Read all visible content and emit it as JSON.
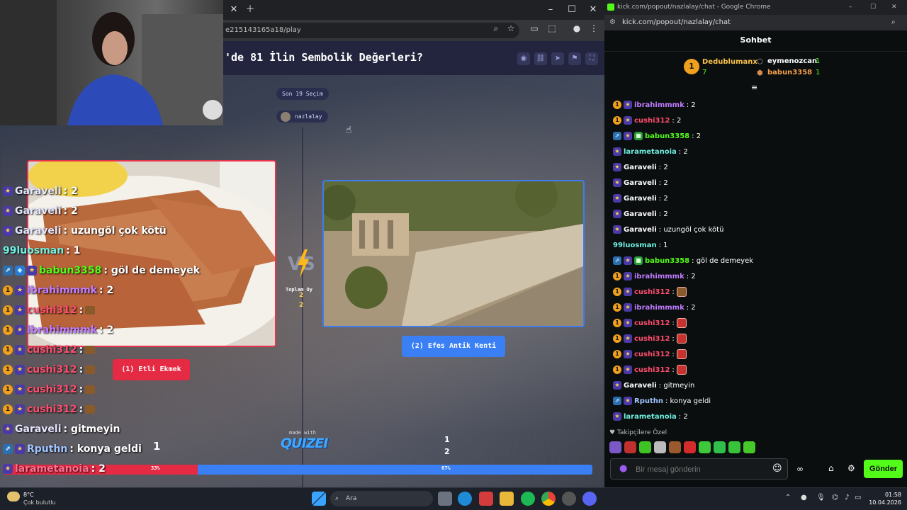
{
  "browser_left": {
    "address": "e215143165a18/play",
    "quiz_title": "'de 81 İlin Sembolik Değerleri?",
    "recent_pill": "Son 19 Seçim",
    "host_pill": "nazlalay",
    "option1_label": "(1) Etli Ekmek",
    "option2_label": "(2) Efes Antik Kenti",
    "vs_text": "VS",
    "total_label": "Toplam Oy",
    "total_num_top": "2",
    "total_num_bottom": "2",
    "made_with": "made with",
    "logo": "QUIZEI",
    "count_left": "1",
    "count_right_top": "1",
    "count_right_bottom": "2",
    "bar_left_pct": "33%",
    "bar_right_pct": "67%",
    "bar_left_value": 33
  },
  "overlay_chat": [
    {
      "user": "Garaveli",
      "text": " : 2",
      "color": "#e7e7ff",
      "badges": [
        "sub"
      ]
    },
    {
      "user": "Garaveli",
      "text": " : 2",
      "color": "#e7e7ff",
      "badges": [
        "sub"
      ]
    },
    {
      "user": "Garaveli",
      "text": " : uzungöl çok kötü",
      "color": "#e7e7ff",
      "badges": [
        "sub"
      ]
    },
    {
      "user": "99luosman",
      "text": " : 1",
      "color": "#6ff0e0",
      "badges": []
    },
    {
      "user": "babun3358",
      "text": " : göl de demeyek",
      "color": "#53fc18",
      "badges": [
        "og",
        "gift",
        "sub"
      ]
    },
    {
      "user": "ibrahimmmk",
      "text": " : 2",
      "color": "#c07cff",
      "badges": [
        "one",
        "sub"
      ]
    },
    {
      "user": "cushi312",
      "text": " :",
      "color": "#ff4d6d",
      "badges": [
        "one",
        "sub"
      ],
      "emote": true
    },
    {
      "user": "ibrahimmmk",
      "text": " : 2",
      "color": "#c07cff",
      "badges": [
        "one",
        "sub"
      ]
    },
    {
      "user": "cushi312",
      "text": " :",
      "color": "#ff4d6d",
      "badges": [
        "one",
        "sub"
      ],
      "emote": true
    },
    {
      "user": "cushi312",
      "text": " :",
      "color": "#ff4d6d",
      "badges": [
        "one",
        "sub"
      ],
      "emote": true
    },
    {
      "user": "cushi312",
      "text": " :",
      "color": "#ff4d6d",
      "badges": [
        "one",
        "sub"
      ],
      "emote": true
    },
    {
      "user": "cushi312",
      "text": " :",
      "color": "#ff4d6d",
      "badges": [
        "one",
        "sub"
      ],
      "emote": true
    },
    {
      "user": "Garaveli",
      "text": " : gitmeyin",
      "color": "#e7e7ff",
      "badges": [
        "sub"
      ]
    },
    {
      "user": "Rputhn",
      "text": " : konya geldi",
      "color": "#9fc4ff",
      "badges": [
        "og",
        "sub"
      ]
    },
    {
      "user": "larametanoia",
      "text": " : 2",
      "color": "#ff6f8f",
      "badges": [
        "sub"
      ]
    }
  ],
  "chat_window": {
    "title": "kick.com/popout/nazlalay/chat - Google Chrome",
    "address": "kick.com/popout/nazlalay/chat",
    "header": "Sohbet",
    "leaderboard": [
      {
        "rank": "1",
        "name": "Dedublumanx",
        "count": "7",
        "color": "#f7c14b"
      },
      {
        "rank": "",
        "name": "eymenozcan",
        "count": "1",
        "color": "#ffffff"
      },
      {
        "rank": "",
        "name": "babun3358",
        "count": "1",
        "color": "#f7a14b"
      }
    ],
    "messages": [
      {
        "user": "ibrahimmmk",
        "text": ": 2",
        "color": "#c07cff",
        "badges": [
          "one",
          "sub"
        ]
      },
      {
        "user": "cushi312",
        "text": ": 2",
        "color": "#ff4d6d",
        "badges": [
          "one",
          "sub"
        ]
      },
      {
        "user": "babun3358",
        "text": ": 2",
        "color": "#53fc18",
        "badges": [
          "og",
          "sub",
          "gift"
        ]
      },
      {
        "user": "larametanoia",
        "text": ": 2",
        "color": "#6ff0e0",
        "badges": [
          "sub"
        ]
      },
      {
        "user": "Garaveli",
        "text": ": 2",
        "color": "#ffffff",
        "badges": [
          "sub"
        ]
      },
      {
        "user": "Garaveli",
        "text": ": 2",
        "color": "#ffffff",
        "badges": [
          "sub"
        ]
      },
      {
        "user": "Garaveli",
        "text": ": 2",
        "color": "#ffffff",
        "badges": [
          "sub"
        ]
      },
      {
        "user": "Garaveli",
        "text": ": 2",
        "color": "#ffffff",
        "badges": [
          "sub"
        ]
      },
      {
        "user": "Garaveli",
        "text": ": uzungöl çok kötü",
        "color": "#ffffff",
        "badges": [
          "sub"
        ]
      },
      {
        "user": "99luosman",
        "text": ": 1",
        "color": "#6ff0e0",
        "badges": []
      },
      {
        "user": "babun3358",
        "text": ": göl de demeyek",
        "color": "#53fc18",
        "badges": [
          "og",
          "sub",
          "gift"
        ]
      },
      {
        "user": "ibrahimmmk",
        "text": ": 2",
        "color": "#c07cff",
        "badges": [
          "one",
          "sub"
        ]
      },
      {
        "user": "cushi312",
        "text": ":",
        "color": "#ff4d6d",
        "badges": [
          "one",
          "sub"
        ],
        "emote": "brown"
      },
      {
        "user": "ibrahimmmk",
        "text": ": 2",
        "color": "#c07cff",
        "badges": [
          "one",
          "sub"
        ]
      },
      {
        "user": "cushi312",
        "text": ":",
        "color": "#ff4d6d",
        "badges": [
          "one",
          "sub"
        ],
        "emote": "red"
      },
      {
        "user": "cushi312",
        "text": ":",
        "color": "#ff4d6d",
        "badges": [
          "one",
          "sub"
        ],
        "emote": "red"
      },
      {
        "user": "cushi312",
        "text": ":",
        "color": "#ff4d6d",
        "badges": [
          "one",
          "sub"
        ],
        "emote": "red"
      },
      {
        "user": "cushi312",
        "text": ":",
        "color": "#ff4d6d",
        "badges": [
          "one",
          "sub"
        ],
        "emote": "red"
      },
      {
        "user": "Garaveli",
        "text": ": gitmeyin",
        "color": "#ffffff",
        "badges": [
          "sub"
        ]
      },
      {
        "user": "Rputhn",
        "text": ": konya geldi",
        "color": "#9fc4ff",
        "badges": [
          "og",
          "sub"
        ]
      },
      {
        "user": "larametanoia",
        "text": ": 2",
        "color": "#6ff0e0",
        "badges": [
          "sub"
        ]
      }
    ],
    "followers_only": "Takipçilere Özel",
    "input_placeholder": "Bir mesaj gönderin",
    "send_label": "Gönder"
  },
  "taskbar": {
    "temp": "8°C",
    "weather": "Çok bulutlu",
    "search_label": "Ara",
    "time": "01:58",
    "date": "10.04.2026"
  },
  "colors": {
    "kick_green": "#53fc18",
    "option1_red": "#e52a43",
    "option2_blue": "#3a7ff4",
    "quiz_header": "#23253f"
  }
}
